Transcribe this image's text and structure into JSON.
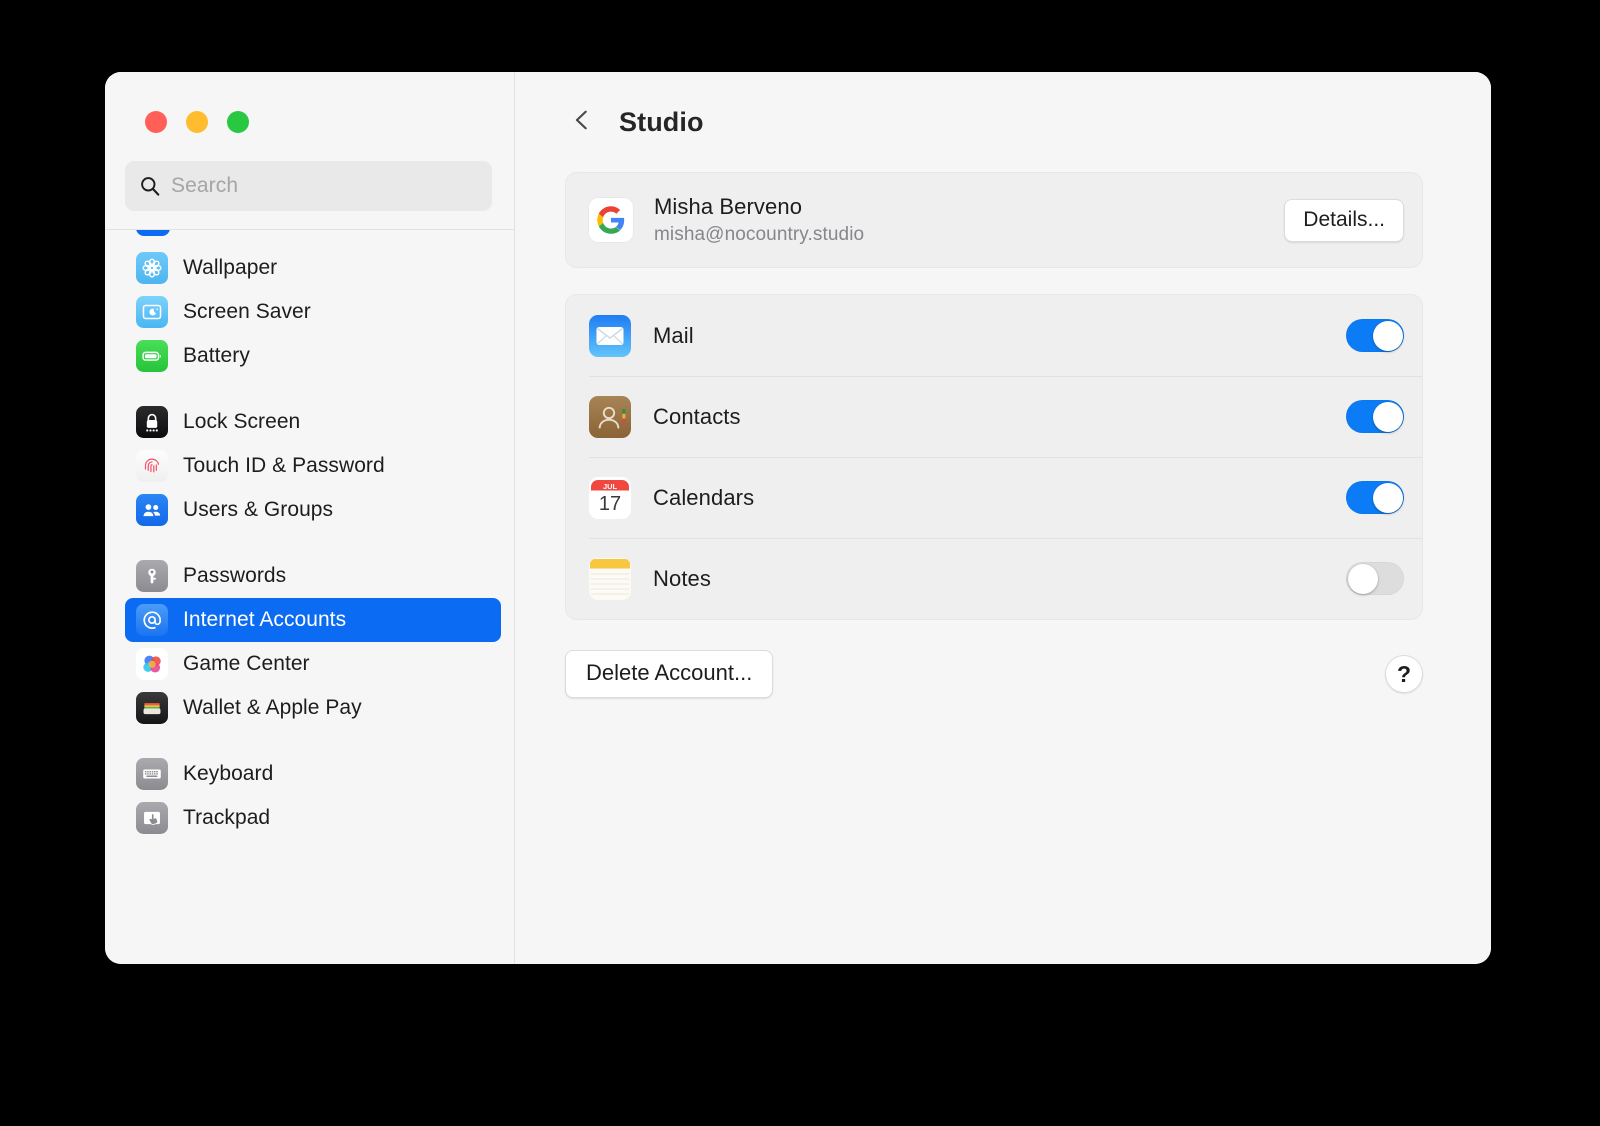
{
  "window": {
    "traffic_lights": [
      {
        "name": "close",
        "color": "#ff5f57"
      },
      {
        "name": "minimize",
        "color": "#febc2e"
      },
      {
        "name": "zoom",
        "color": "#28c840"
      }
    ]
  },
  "search": {
    "placeholder": "Search",
    "value": "",
    "icon": "search-icon"
  },
  "sidebar": {
    "groups": [
      {
        "items": [
          {
            "label": "Wallpaper",
            "icon": "wallpaper-icon",
            "selected": false
          },
          {
            "label": "Screen Saver",
            "icon": "screen-saver-icon",
            "selected": false
          },
          {
            "label": "Battery",
            "icon": "battery-icon",
            "selected": false
          }
        ]
      },
      {
        "items": [
          {
            "label": "Lock Screen",
            "icon": "lock-screen-icon",
            "selected": false
          },
          {
            "label": "Touch ID & Password",
            "icon": "touch-id-icon",
            "selected": false
          },
          {
            "label": "Users & Groups",
            "icon": "users-groups-icon",
            "selected": false
          }
        ]
      },
      {
        "items": [
          {
            "label": "Passwords",
            "icon": "passwords-key-icon",
            "selected": false
          },
          {
            "label": "Internet Accounts",
            "icon": "internet-accounts-at-icon",
            "selected": true
          },
          {
            "label": "Game Center",
            "icon": "game-center-icon",
            "selected": false
          },
          {
            "label": "Wallet & Apple Pay",
            "icon": "wallet-icon",
            "selected": false
          }
        ]
      },
      {
        "items": [
          {
            "label": "Keyboard",
            "icon": "keyboard-icon",
            "selected": false
          },
          {
            "label": "Trackpad",
            "icon": "trackpad-icon",
            "selected": false
          }
        ]
      }
    ]
  },
  "content": {
    "back_icon": "chevron-left-icon",
    "title": "Studio",
    "account": {
      "provider_icon": "google-g-icon",
      "name": "Misha Berveno",
      "email": "misha@nocountry.studio",
      "details_label": "Details..."
    },
    "services": [
      {
        "label": "Mail",
        "icon": "mail-app-icon",
        "enabled": true
      },
      {
        "label": "Contacts",
        "icon": "contacts-app-icon",
        "enabled": true
      },
      {
        "label": "Calendars",
        "icon": "calendar-app-icon",
        "enabled": true
      },
      {
        "label": "Notes",
        "icon": "notes-app-icon",
        "enabled": false
      }
    ],
    "calendar_icon_text": {
      "month": "JUL",
      "day": "17"
    },
    "delete_label": "Delete Account...",
    "help_label": "?"
  },
  "colors": {
    "accent": "#0b6bf2",
    "toggle_on": "#0b7cf6",
    "toggle_off": "#dddddd",
    "window_bg": "#f6f6f6",
    "card_bg": "#efeff0"
  }
}
